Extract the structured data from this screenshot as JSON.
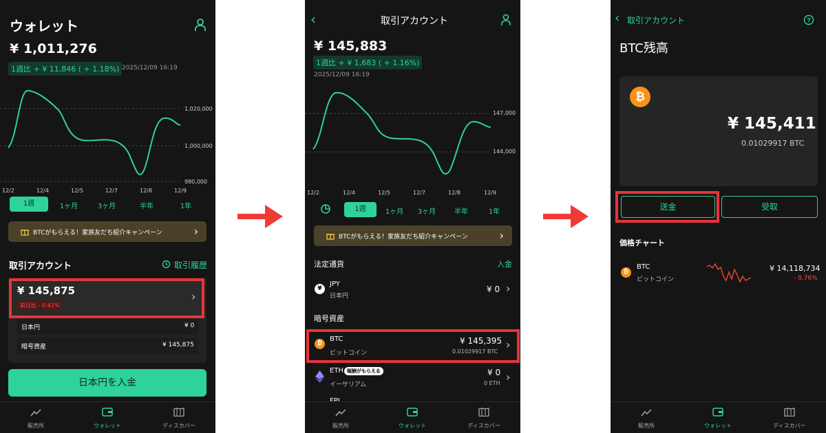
{
  "screen1": {
    "title": "ウォレット",
    "total": "¥ 1,011,276",
    "change": "1週比 + ¥ 11,846 ( + 1.18%)",
    "timestamp": "2025/12/09 16:19",
    "y_ticks": [
      "1,020,000",
      "1,000,000",
      "980,000"
    ],
    "x_ticks": [
      "12/2",
      "12/4",
      "12/5",
      "12/7",
      "12/8",
      "12/9"
    ],
    "tabs": [
      "1週",
      "1ヶ月",
      "3ヶ月",
      "半年",
      "1年"
    ],
    "banner": "BTCがもらえる！家族友だち紹介キャンペーン",
    "section_title": "取引アカウント",
    "history_link": "取引履歴",
    "account_value": "¥ 145,875",
    "account_change": "前日比 - 0.41%",
    "rows": [
      {
        "label": "日本円",
        "value": "¥ 0"
      },
      {
        "label": "暗号資産",
        "value": "¥ 145,875"
      }
    ],
    "deposit_button": "日本円を入金"
  },
  "screen2": {
    "title": "取引アカウント",
    "total": "¥ 145,883",
    "change": "1週比 + ¥ 1,683 ( + 1.16%)",
    "timestamp": "2025/12/09 16:19",
    "y_ticks": [
      "147,000",
      "144,000"
    ],
    "x_ticks": [
      "12/2",
      "12/4",
      "12/5",
      "12/7",
      "12/8",
      "12/9"
    ],
    "tabs": [
      "1週",
      "1ヶ月",
      "3ヶ月",
      "半年",
      "1年"
    ],
    "banner": "BTCがもらえる！家族友だち紹介キャンペーン",
    "fiat_header": "法定通貨",
    "deposit_link": "入金",
    "jpy": {
      "symbol": "JPY",
      "name": "日本円",
      "value": "¥ 0"
    },
    "crypto_header": "暗号資産",
    "btc": {
      "symbol": "BTC",
      "name": "ビットコイン",
      "value": "¥ 145,395",
      "amount": "0.01029917 BTC"
    },
    "eth": {
      "symbol": "ETH",
      "badge": "報酬がもらえる",
      "name": "イーサリアム",
      "value": "¥ 0",
      "amount": "0 ETH"
    },
    "cut_row": "FPL"
  },
  "screen3": {
    "back_label": "取引アカウント",
    "title": "BTC残高",
    "value": "¥ 145,411",
    "amount": "0.01029917 BTC",
    "send_button": "送金",
    "receive_button": "受取",
    "price_chart_title": "価格チャート",
    "coin_symbol": "BTC",
    "coin_name": "ビットコイン",
    "price": "¥ 14,118,734",
    "price_change": "- 0.76%"
  },
  "nav": {
    "items": [
      "販売所",
      "ウォレット",
      "ディスカバー"
    ]
  },
  "colors": {
    "accent": "#2fd39a",
    "highlight": "#e8343a",
    "background": "#151515",
    "btc": "#f7931a"
  }
}
